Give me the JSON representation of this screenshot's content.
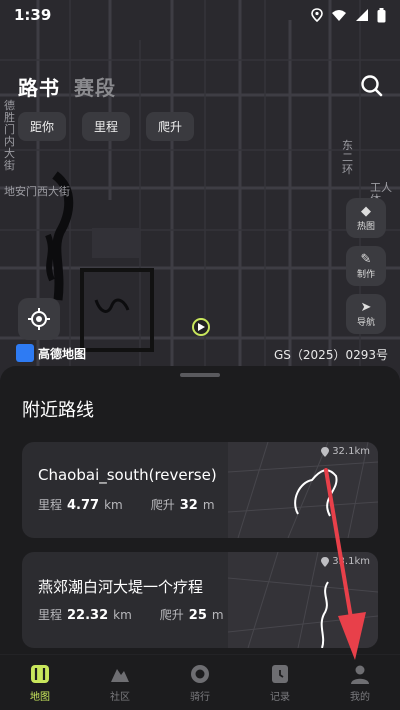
{
  "status": {
    "time": "1:39"
  },
  "header": {
    "tabs": [
      {
        "label": "路书",
        "active": true
      },
      {
        "label": "赛段",
        "active": false
      }
    ]
  },
  "filters": [
    "距你",
    "里程",
    "爬升"
  ],
  "map": {
    "labels": [
      "德胜门内大街",
      "地安门西大街",
      "东二环",
      "工人体"
    ],
    "tools": [
      {
        "label": "热图",
        "icon": "heatmap-icon"
      },
      {
        "label": "制作",
        "icon": "edit-icon"
      },
      {
        "label": "导航",
        "icon": "navigate-icon"
      }
    ],
    "provider": "高德地图",
    "license": "GS（2025）0293号"
  },
  "sheet": {
    "title": "附近路线",
    "routes": [
      {
        "name": "Chaobai_south(reverse)",
        "distance_label": "里程",
        "distance": "4.77",
        "distance_unit": "km",
        "climb_label": "爬升",
        "climb": "32",
        "climb_unit": "m",
        "away": "32.1km"
      },
      {
        "name": "燕郊潮白河大堤一个疗程",
        "distance_label": "里程",
        "distance": "22.32",
        "distance_unit": "km",
        "climb_label": "爬升",
        "climb": "25",
        "climb_unit": "m",
        "away": "33.1km"
      }
    ]
  },
  "nav": [
    {
      "label": "地图",
      "icon": "map-icon",
      "active": true
    },
    {
      "label": "社区",
      "icon": "community-icon",
      "active": false
    },
    {
      "label": "骑行",
      "icon": "ride-icon",
      "active": false
    },
    {
      "label": "记录",
      "icon": "record-icon",
      "active": false
    },
    {
      "label": "我的",
      "icon": "profile-icon",
      "active": false
    }
  ],
  "colors": {
    "accent": "#c8e65c",
    "annotation": "#e8404a",
    "sheet": "#1c1c1e",
    "card": "#2c2c30"
  }
}
